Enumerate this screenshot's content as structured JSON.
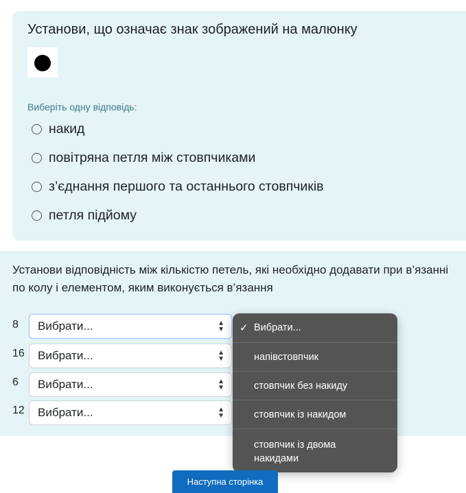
{
  "question1": {
    "text": "Установи, що означає знак зображений на малюнку",
    "image_icon": "filled-circle-symbol",
    "prompt": "Виберіть одну відповідь:",
    "options": [
      "накид",
      "повітряна петля між стовпчиками",
      "з’єднання першого та останнього стовпчиків",
      "петля підйому"
    ]
  },
  "question2": {
    "text": "Установи відповідність між кількістю петель, які необхідно додавати при в’язанні по колу і елементом, яким виконується в’язання",
    "rows": [
      {
        "label": "8",
        "value": "Вибрати..."
      },
      {
        "label": "16",
        "value": "Вибрати..."
      },
      {
        "label": "6",
        "value": "Вибрати..."
      },
      {
        "label": "12",
        "value": "Вибрати..."
      }
    ],
    "dropdown": {
      "selected_mark": "✓",
      "options": [
        "Вибрати...",
        "напівстовпчик",
        "стовпчик без накиду",
        "стовпчик із накидом",
        "стовпчик із двома накидами"
      ]
    }
  },
  "next_button": "Наступна сторінка",
  "colors": {
    "card_bg": "#e5f4f6",
    "dropdown_bg": "#545454",
    "button_bg": "#0f6cbf",
    "prompt_text": "#3b7a8a"
  }
}
